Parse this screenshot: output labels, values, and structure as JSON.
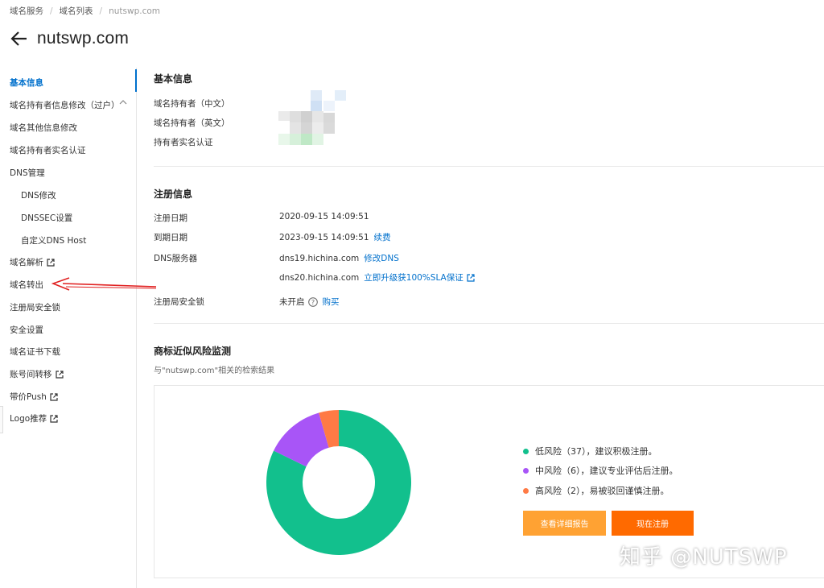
{
  "breadcrumb": [
    "域名服务",
    "域名列表",
    "nutswp.com"
  ],
  "page_title": "nutswp.com",
  "sidebar": {
    "items": [
      {
        "label": "基本信息",
        "external": false
      },
      {
        "label": "域名持有者信息修改（过户）",
        "external": false
      },
      {
        "label": "域名其他信息修改",
        "external": false
      },
      {
        "label": "域名持有者实名认证",
        "external": false
      },
      {
        "label": "DNS管理",
        "external": false
      },
      {
        "label": "DNS修改",
        "external": false
      },
      {
        "label": "DNSSEC设置",
        "external": false
      },
      {
        "label": "自定义DNS Host",
        "external": false
      },
      {
        "label": "域名解析",
        "external": true
      },
      {
        "label": "域名转出",
        "external": false
      },
      {
        "label": "注册局安全锁",
        "external": false
      },
      {
        "label": "安全设置",
        "external": false
      },
      {
        "label": "域名证书下载",
        "external": false
      },
      {
        "label": "账号间转移",
        "external": true
      },
      {
        "label": "带价Push",
        "external": true
      },
      {
        "label": "Logo推荐",
        "external": true
      }
    ]
  },
  "basic_info": {
    "title": "基本信息",
    "owner_cn_label": "域名持有者（中文）",
    "owner_en_label": "域名持有者（英文）",
    "verification_label": "持有者实名认证"
  },
  "registration": {
    "title": "注册信息",
    "reg_date_label": "注册日期",
    "reg_date": "2020-09-15 14:09:51",
    "expire_label": "到期日期",
    "expire_date": "2023-09-15 14:09:51",
    "renew_link": "续费",
    "dns_label": "DNS服务器",
    "dns1": "dns19.hichina.com",
    "modify_dns_link": "修改DNS",
    "dns2": "dns20.hichina.com",
    "upgrade_link": "立即升级获100%SLA保证",
    "lock_label": "注册局安全锁",
    "lock_value": "未开启",
    "buy_link": "购买"
  },
  "trademark": {
    "title": "商标近似风险监测",
    "subtitle": "与\"nutswp.com\"相关的检索结果",
    "legend": [
      {
        "text": "低风险（37），建议积极注册。",
        "color": "#12c08d"
      },
      {
        "text": "中风险（6），建议专业评估后注册。",
        "color": "#a855f7"
      },
      {
        "text": "高风险（2），易被驳回谨慎注册。",
        "color": "#ff7a45"
      }
    ],
    "report_button": "查看详细报告",
    "register_button": "现在注册"
  },
  "chart_data": {
    "type": "pie",
    "donut": true,
    "categories": [
      "低风险",
      "中风险",
      "高风险"
    ],
    "values": [
      37,
      6,
      2
    ],
    "colors": [
      "#12c08d",
      "#a855f7",
      "#ff7a45"
    ]
  },
  "watermark": "知乎 @NUTSWP"
}
